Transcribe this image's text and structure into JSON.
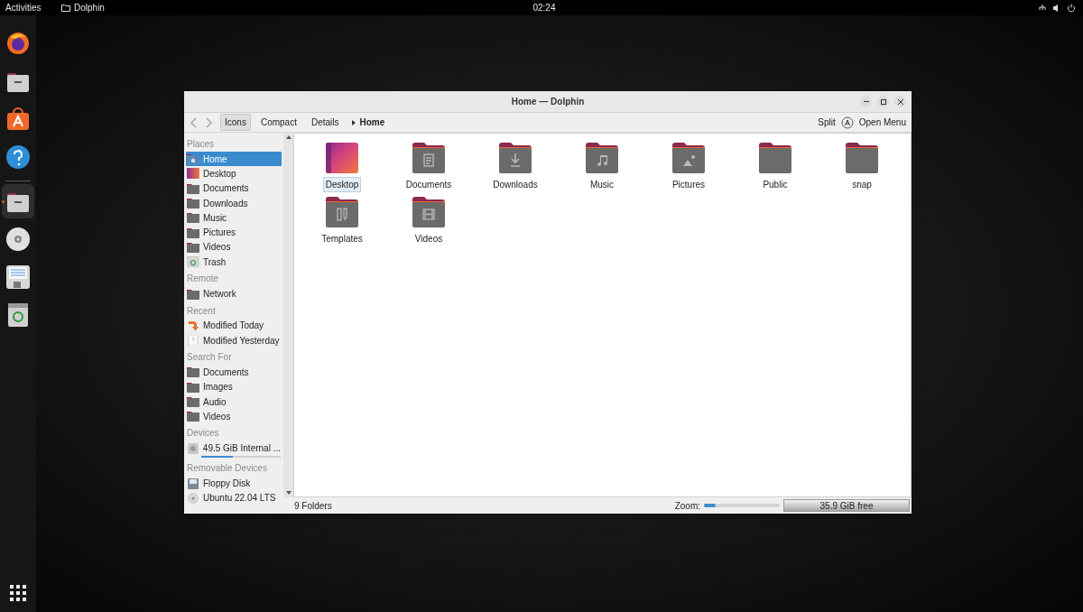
{
  "top_bar": {
    "activities": "Activities",
    "app_name": "Dolphin",
    "clock": "02:24"
  },
  "dock": [
    {
      "kind": "browser",
      "selected": false
    },
    {
      "kind": "files",
      "selected": false
    },
    {
      "kind": "store",
      "selected": false
    },
    {
      "kind": "help",
      "selected": false
    },
    {
      "kind": "files",
      "selected": true
    },
    {
      "kind": "disc",
      "selected": false
    },
    {
      "kind": "floppy",
      "selected": false
    },
    {
      "kind": "trash",
      "selected": false
    }
  ],
  "window": {
    "title": "Home — Dolphin",
    "toolbar": {
      "view_modes": [
        {
          "label": "Icons",
          "selected": true
        },
        {
          "label": "Compact",
          "selected": false
        },
        {
          "label": "Details",
          "selected": false
        }
      ],
      "breadcrumb": "Home",
      "split": "Split",
      "open_menu": "Open Menu"
    },
    "sidebar": [
      {
        "heading": "Places",
        "items": [
          {
            "label": "Home",
            "kind": "home",
            "selected": true
          },
          {
            "label": "Desktop",
            "kind": "desktop",
            "selected": false
          },
          {
            "label": "Documents",
            "kind": "folder",
            "selected": false
          },
          {
            "label": "Downloads",
            "kind": "folder",
            "selected": false
          },
          {
            "label": "Music",
            "kind": "folder",
            "selected": false
          },
          {
            "label": "Pictures",
            "kind": "folder",
            "selected": false
          },
          {
            "label": "Videos",
            "kind": "folder",
            "selected": false
          },
          {
            "label": "Trash",
            "kind": "trash",
            "selected": false
          }
        ]
      },
      {
        "heading": "Remote",
        "items": [
          {
            "label": "Network",
            "kind": "folder",
            "selected": false
          }
        ]
      },
      {
        "heading": "Recent",
        "items": [
          {
            "label": "Modified Today",
            "kind": "recent",
            "selected": false
          },
          {
            "label": "Modified Yesterday",
            "kind": "page",
            "selected": false
          }
        ]
      },
      {
        "heading": "Search For",
        "items": [
          {
            "label": "Documents",
            "kind": "folder",
            "selected": false
          },
          {
            "label": "Images",
            "kind": "folder",
            "selected": false
          },
          {
            "label": "Audio",
            "kind": "folder",
            "selected": false
          },
          {
            "label": "Videos",
            "kind": "folder",
            "selected": false
          }
        ]
      },
      {
        "heading": "Devices",
        "items": [
          {
            "label": "49.5 GiB Internal ...",
            "kind": "drive",
            "selected": false,
            "level": 0.4
          }
        ]
      },
      {
        "heading": "Removable Devices",
        "items": [
          {
            "label": "Floppy Disk",
            "kind": "floppy",
            "selected": false
          },
          {
            "label": "Ubuntu 22.04 LTS",
            "kind": "disc",
            "selected": false
          }
        ]
      }
    ],
    "files": [
      {
        "name": "Desktop",
        "kind": "desktop",
        "selected": true
      },
      {
        "name": "Documents",
        "kind": "documents",
        "selected": false
      },
      {
        "name": "Downloads",
        "kind": "downloads",
        "selected": false
      },
      {
        "name": "Music",
        "kind": "music",
        "selected": false
      },
      {
        "name": "Pictures",
        "kind": "pictures",
        "selected": false
      },
      {
        "name": "Public",
        "kind": "plain",
        "selected": false
      },
      {
        "name": "snap",
        "kind": "plain",
        "selected": false
      },
      {
        "name": "Templates",
        "kind": "templates",
        "selected": false
      },
      {
        "name": "Videos",
        "kind": "videos",
        "selected": false
      }
    ],
    "status_bar": {
      "count": "9 Folders",
      "zoom_label": "Zoom:",
      "zoom": {
        "level": 0.15
      },
      "free_space": "35.9 GiB free"
    }
  }
}
